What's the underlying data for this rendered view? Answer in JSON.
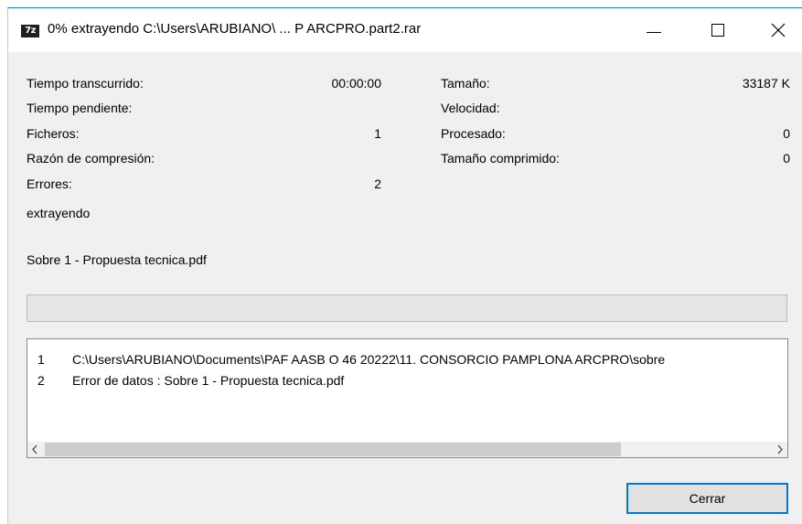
{
  "window": {
    "icon_text": "7z",
    "title": "0% extrayendo C:\\Users\\ARUBIANO\\ ... P ARCPRO.part2.rar"
  },
  "stats_left": [
    {
      "label": "Tiempo transcurrido:",
      "value": "00:00:00"
    },
    {
      "label": "Tiempo pendiente:",
      "value": ""
    },
    {
      "label": "Ficheros:",
      "value": "1"
    },
    {
      "label": "Razón de compresión:",
      "value": ""
    },
    {
      "label": "Errores:",
      "value": "2"
    }
  ],
  "stats_right": [
    {
      "label": "Tamaño:",
      "value": "33187 K"
    },
    {
      "label": "Velocidad:",
      "value": ""
    },
    {
      "label": "Procesado:",
      "value": "0"
    },
    {
      "label": "Tamaño comprimido:",
      "value": "0"
    }
  ],
  "status": "extrayendo",
  "current_file": "Sobre 1 - Propuesta tecnica.pdf",
  "progress": {
    "percent": 0
  },
  "log": [
    {
      "num": "1",
      "text": "C:\\Users\\ARUBIANO\\Documents\\PAF AASB O 46 20222\\11. CONSORCIO PAMPLONA ARCPRO\\sobre"
    },
    {
      "num": "2",
      "text": "Error de datos : Sobre 1 - Propuesta tecnica.pdf"
    }
  ],
  "buttons": {
    "close_label": "Cerrar"
  },
  "colors": {
    "accent": "#0078d7",
    "title_border": "#1883d7"
  }
}
